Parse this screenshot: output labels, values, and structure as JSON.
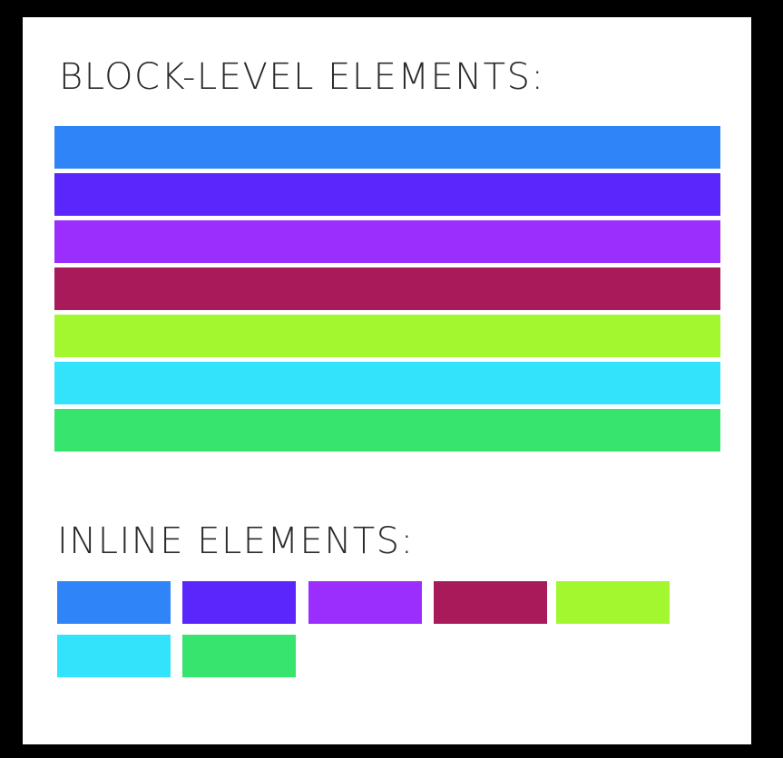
{
  "block_section": {
    "title": "BLOCK-LEVEL ELEMENTS:",
    "bars": [
      {
        "color": "#2f84f7"
      },
      {
        "color": "#5a26fb"
      },
      {
        "color": "#9b2efc"
      },
      {
        "color": "#a81a59"
      },
      {
        "color": "#a2f72f"
      },
      {
        "color": "#33e3fb"
      },
      {
        "color": "#36e46e"
      }
    ]
  },
  "inline_section": {
    "title": "INLINE ELEMENTS:",
    "boxes": [
      {
        "color": "#2f84f7"
      },
      {
        "color": "#5a26fb"
      },
      {
        "color": "#9b2efc"
      },
      {
        "color": "#a81a59"
      },
      {
        "color": "#a2f72f"
      },
      {
        "color": "#33e3fb"
      },
      {
        "color": "#36e46e"
      }
    ]
  }
}
